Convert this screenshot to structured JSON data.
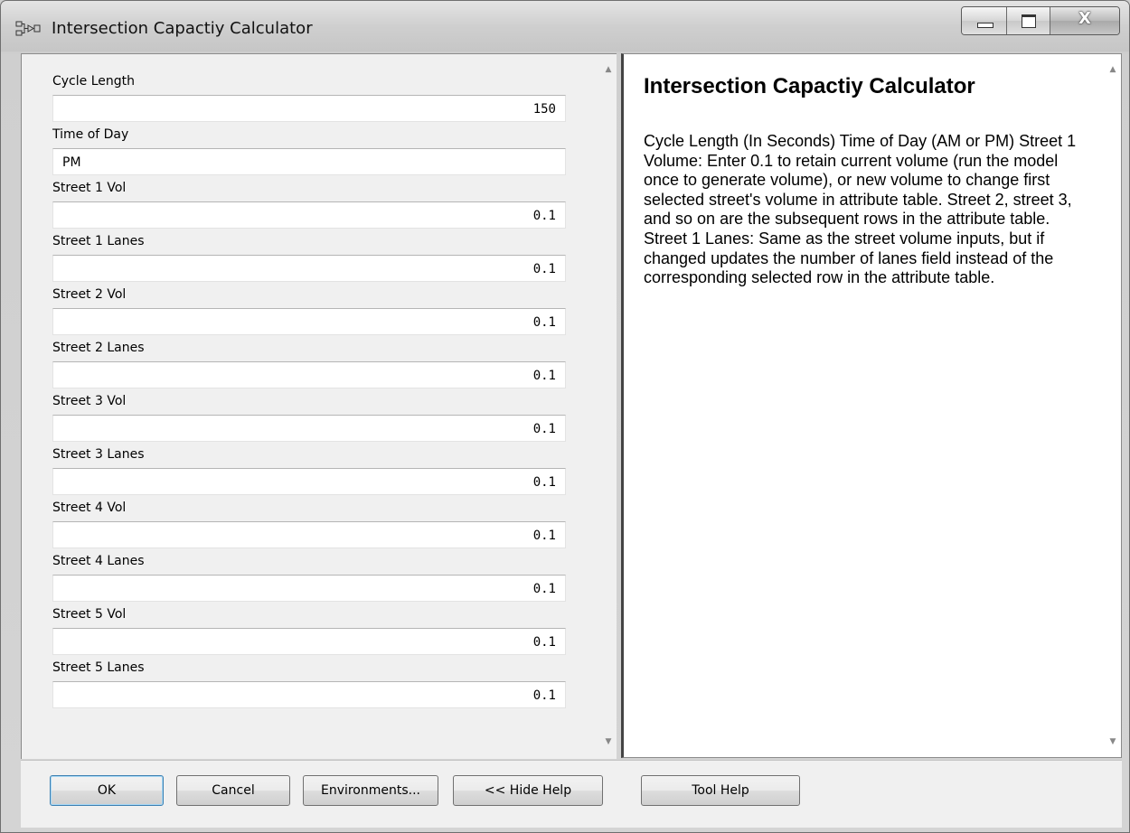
{
  "window": {
    "title": "Intersection Capactiy Calculator",
    "close_glyph": "X"
  },
  "form": {
    "fields": [
      {
        "label": "Cycle Length",
        "value": "150"
      },
      {
        "label": "Time of Day",
        "value": "PM"
      },
      {
        "label": "Street 1 Vol",
        "value": "0.1"
      },
      {
        "label": "Street 1 Lanes",
        "value": "0.1"
      },
      {
        "label": "Street 2 Vol",
        "value": "0.1"
      },
      {
        "label": "Street 2 Lanes",
        "value": "0.1"
      },
      {
        "label": "Street 3 Vol",
        "value": "0.1"
      },
      {
        "label": "Street 3 Lanes",
        "value": "0.1"
      },
      {
        "label": "Street 4 Vol",
        "value": "0.1"
      },
      {
        "label": "Street 4 Lanes",
        "value": "0.1"
      },
      {
        "label": "Street 5 Vol",
        "value": "0.1"
      },
      {
        "label": "Street 5 Lanes",
        "value": "0.1"
      }
    ]
  },
  "help": {
    "title": "Intersection Capactiy Calculator",
    "body": "Cycle Length (In Seconds) Time of Day (AM or PM) Street 1 Volume: Enter 0.1 to retain current volume (run the model once to generate volume), or new volume to change first selected street's volume in attribute table. Street 2, street 3, and so on are the subsequent rows in the attribute table. Street 1 Lanes: Same as the street volume inputs, but if changed updates the number of lanes field instead of the corresponding selected row in the attribute table."
  },
  "buttons": {
    "ok": "OK",
    "cancel": "Cancel",
    "environments": "Environments...",
    "hide_help": "<< Hide Help",
    "tool_help": "Tool Help"
  }
}
